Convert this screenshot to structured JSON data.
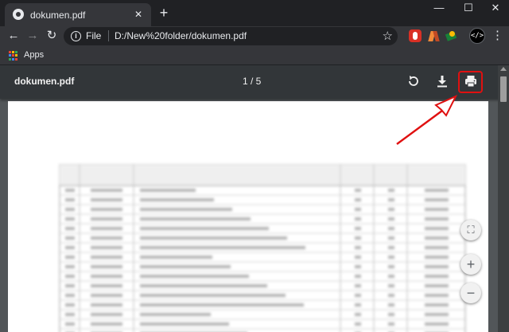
{
  "tab": {
    "title": "dokumen.pdf",
    "close_glyph": "✕",
    "newtab_glyph": "+"
  },
  "window": {
    "minimize": "—",
    "maximize": "☐",
    "close": "✕"
  },
  "toolbar": {
    "back_glyph": "←",
    "forward_glyph": "→",
    "reload_glyph": "↻",
    "scheme": "File",
    "url": "D:/New%20folder/dokumen.pdf",
    "star_glyph": "☆",
    "menu_glyph": "⋮",
    "devtools_glyph": "</>"
  },
  "bookmarks": {
    "apps_label": "Apps",
    "apps_colors": [
      "#ea4335",
      "#fbbc04",
      "#34a853",
      "#4285f4",
      "#ea4335",
      "#fbbc04",
      "#34a853",
      "#4285f4",
      "#ea4335"
    ]
  },
  "pdf": {
    "title": "dokumen.pdf",
    "page_indicator": "1 / 5",
    "icons": [
      "rotate-icon",
      "download-icon",
      "print-icon"
    ]
  },
  "zoom": {
    "fit_glyph": "⛶",
    "in_glyph": "+",
    "out_glyph": "−"
  },
  "colors": {
    "annotation": "#e01010",
    "viewer_bg": "#525659",
    "toolbar_bg": "#323639"
  }
}
